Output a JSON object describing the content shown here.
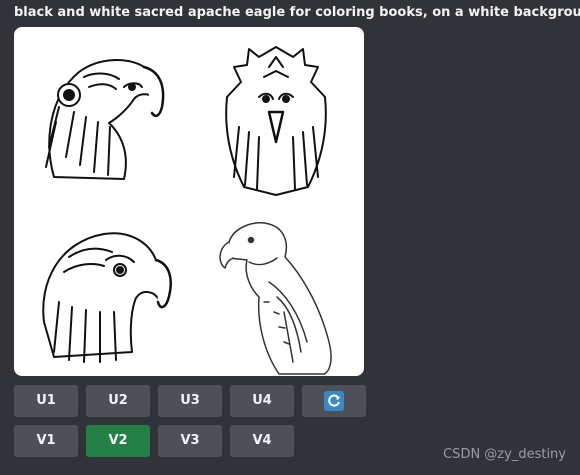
{
  "message": {
    "prompt_text": "black and white sacred apache eagle for coloring books, on a white background -"
  },
  "upscale_buttons": [
    "U1",
    "U2",
    "U3",
    "U4"
  ],
  "variation_buttons": [
    "V1",
    "V2",
    "V3",
    "V4"
  ],
  "active_variation": "V2",
  "refresh_icon": "refresh-icon",
  "watermark": "CSDN @zy_destiny",
  "colors": {
    "background": "#313338",
    "button": "#4e5058",
    "active_button": "#248046",
    "refresh": "#3b88c3"
  }
}
